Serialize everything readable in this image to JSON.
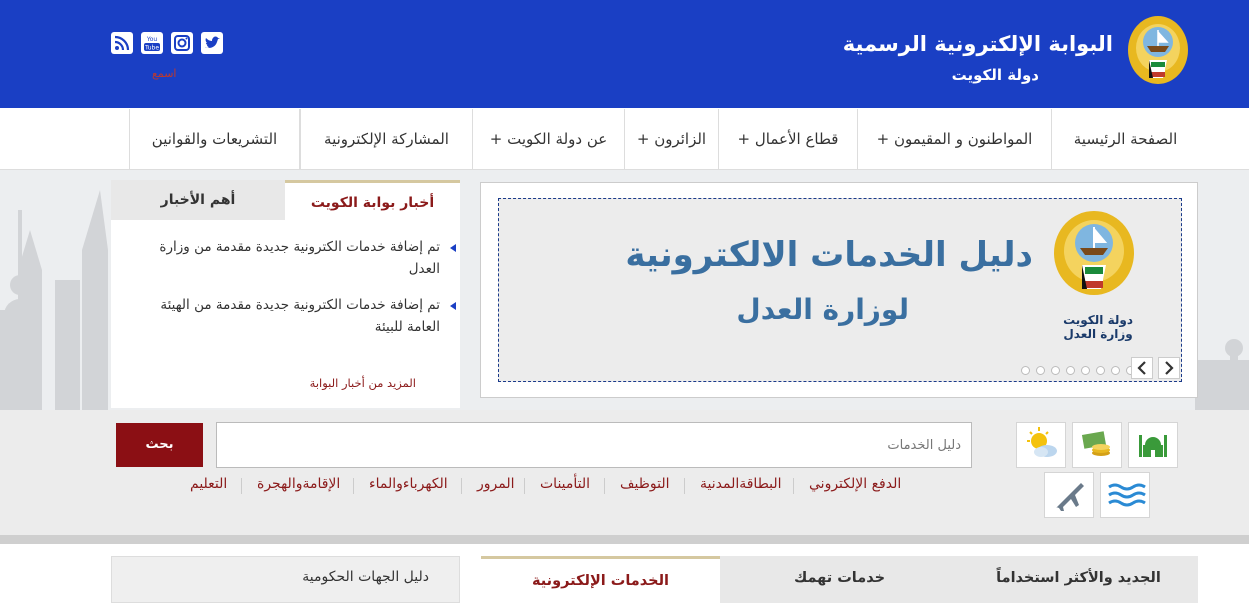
{
  "header": {
    "title": "البوابة الإلكترونية الرسمية",
    "subtitle": "دولة  الكويت",
    "social_label": "اسمع",
    "social_icons": [
      "rss-icon",
      "youtube-icon",
      "instagram-icon",
      "twitter-icon"
    ]
  },
  "nav": {
    "items": [
      {
        "label": "الصفحة الرئيسية"
      },
      {
        "label": "المواطنون و المقيمون +"
      },
      {
        "label": "قطاع الأعمال +"
      },
      {
        "label": "الزائرون +"
      },
      {
        "label": "عن دولة الكويت +"
      },
      {
        "label": "المشاركة الإلكترونية"
      },
      {
        "label": "التشريعات والقوانين"
      }
    ]
  },
  "news": {
    "tabs": [
      "أخبار بوابة الكويت",
      "أهم الأخبار"
    ],
    "items": [
      {
        "text": "تم إضافة خدمات الكترونية جديدة مقدمة من وزارة العدل"
      },
      {
        "text": "تم إضافة خدمات الكترونية جديدة مقدمة من الهيئة العامة للبيئة"
      }
    ],
    "more": "المزيد من أخبار البوابة"
  },
  "slider": {
    "title": "دليل الخدمات الالكترونية",
    "subtitle": "لوزارة العدل",
    "emblem_text_1": "دولة الكويت",
    "emblem_text_2": "وزارة العدل",
    "dot_count": 9,
    "prev_icon": "chevron-left-icon",
    "next_icon": "chevron-right-icon"
  },
  "search": {
    "button": "بحث",
    "placeholder": "دليل الخدمات"
  },
  "quick_links": [
    "الدفع الإلكتروني",
    "البطاقةالمدنية",
    "التوظيف",
    "التأمينات",
    "المرور",
    "الكهرباءوالماء",
    "الإقامةوالهجرة",
    "التعليم"
  ],
  "tiles": [
    "mosque-icon",
    "currency-icon",
    "weather-icon",
    "waves-icon",
    "airplane-icon"
  ],
  "bottom_tabs": [
    "الجديد والأكثر استخداماً",
    "خدمات تهمك",
    "الخدمات الإلكترونية"
  ],
  "gov_directory": "دليل الجهات الحكومية",
  "colors": {
    "header_blue": "#1a3fc4",
    "accent_red": "#8b0f14",
    "slide_text": "#3a6fa0"
  }
}
